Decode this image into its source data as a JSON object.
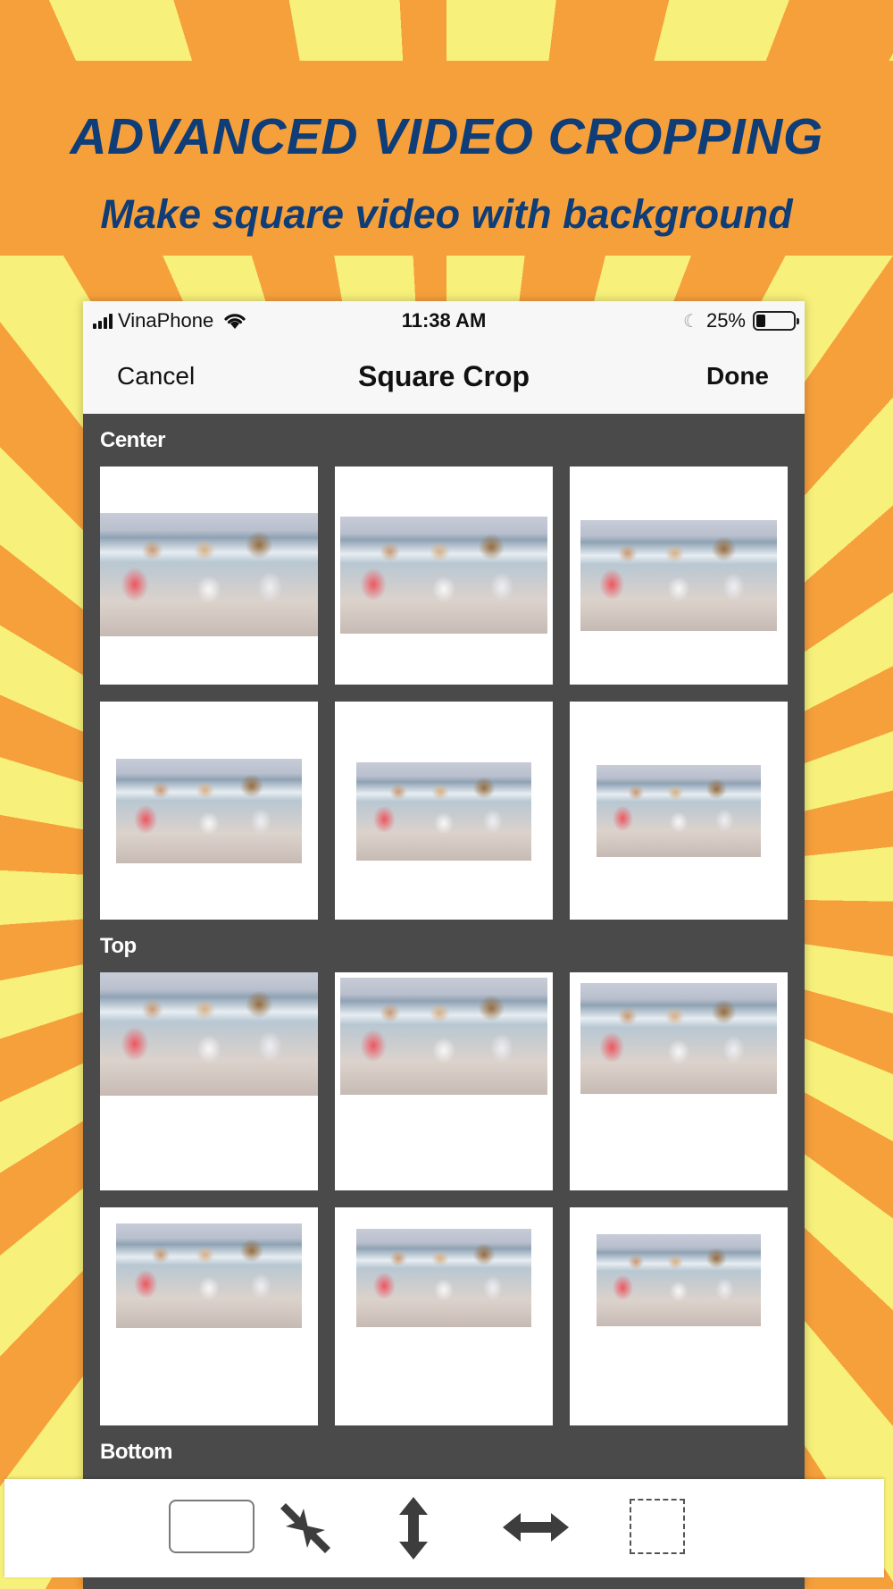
{
  "promo": {
    "headline": "ADVANCED VIDEO CROPPING",
    "subheadline": "Make square video with background"
  },
  "status_bar": {
    "carrier": "VinaPhone",
    "time": "11:38 AM",
    "battery_percent": "25%",
    "battery_level": 0.25
  },
  "nav": {
    "cancel_label": "Cancel",
    "title": "Square Crop",
    "done_label": "Done"
  },
  "sections": {
    "center_label": "Center",
    "top_label": "Top",
    "bottom_label": "Bottom"
  },
  "crop_options": {
    "center": [
      "center-fill",
      "center-large",
      "center-medium",
      "center-small-1",
      "center-small-2",
      "center-small-3"
    ],
    "top": [
      "top-fill",
      "top-large",
      "top-medium",
      "top-small-1",
      "top-small-2",
      "top-small-3"
    ]
  },
  "toolbar": {
    "items": [
      "rectangle-frame-icon",
      "shrink-arrows-icon",
      "vertical-arrows-icon",
      "horizontal-arrows-icon",
      "dashed-square-icon"
    ]
  },
  "colors": {
    "headline": "#0f3d77",
    "background_orange": "#f6a03c",
    "background_yellow": "#f7f07a",
    "grid_background": "#4a4a4a"
  }
}
